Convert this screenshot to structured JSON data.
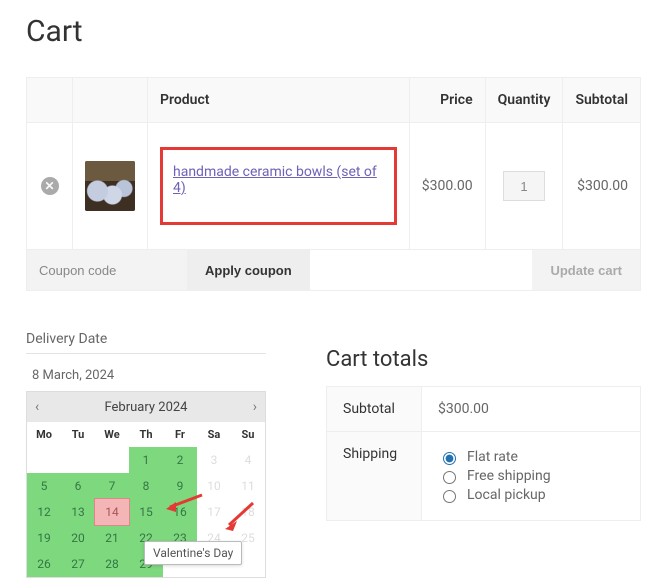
{
  "page_title": "Cart",
  "table": {
    "headers": {
      "product": "Product",
      "price": "Price",
      "quantity": "Quantity",
      "subtotal": "Subtotal"
    },
    "item": {
      "name": "handmade ceramic bowls (set of 4)",
      "price": "$300.00",
      "qty": "1",
      "subtotal": "$300.00"
    }
  },
  "coupon": {
    "placeholder": "Coupon code",
    "apply": "Apply coupon",
    "update": "Update cart"
  },
  "delivery": {
    "label": "Delivery Date",
    "value": "8 March, 2024",
    "month": "February 2024",
    "tooltip": "Valentine's Day",
    "weekdays": [
      "Mo",
      "Tu",
      "We",
      "Th",
      "Fr",
      "Sa",
      "Su"
    ],
    "weeks": [
      [
        {
          "d": "",
          "t": "blank"
        },
        {
          "d": "",
          "t": "blank"
        },
        {
          "d": "",
          "t": "blank"
        },
        {
          "d": "1",
          "t": "avail"
        },
        {
          "d": "2",
          "t": "avail"
        },
        {
          "d": "3",
          "t": "dis"
        },
        {
          "d": "4",
          "t": "dis"
        }
      ],
      [
        {
          "d": "5",
          "t": "avail"
        },
        {
          "d": "6",
          "t": "avail"
        },
        {
          "d": "7",
          "t": "avail"
        },
        {
          "d": "8",
          "t": "avail"
        },
        {
          "d": "9",
          "t": "avail"
        },
        {
          "d": "10",
          "t": "dis"
        },
        {
          "d": "11",
          "t": "dis"
        }
      ],
      [
        {
          "d": "12",
          "t": "avail"
        },
        {
          "d": "13",
          "t": "avail"
        },
        {
          "d": "14",
          "t": "selected"
        },
        {
          "d": "15",
          "t": "avail"
        },
        {
          "d": "16",
          "t": "avail"
        },
        {
          "d": "17",
          "t": "dis"
        },
        {
          "d": "18",
          "t": "dis"
        }
      ],
      [
        {
          "d": "19",
          "t": "avail"
        },
        {
          "d": "20",
          "t": "avail"
        },
        {
          "d": "21",
          "t": "avail"
        },
        {
          "d": "22",
          "t": "avail"
        },
        {
          "d": "23",
          "t": "avail"
        },
        {
          "d": "24",
          "t": "dis"
        },
        {
          "d": "25",
          "t": "dis"
        }
      ],
      [
        {
          "d": "26",
          "t": "avail"
        },
        {
          "d": "27",
          "t": "avail"
        },
        {
          "d": "28",
          "t": "avail"
        },
        {
          "d": "29",
          "t": "avail"
        },
        {
          "d": "",
          "t": "blank"
        },
        {
          "d": "",
          "t": "blank"
        },
        {
          "d": "",
          "t": "blank"
        }
      ]
    ]
  },
  "totals": {
    "title": "Cart totals",
    "subtotal_label": "Subtotal",
    "subtotal": "$300.00",
    "shipping_label": "Shipping",
    "shipping_options": [
      "Flat rate",
      "Free shipping",
      "Local pickup"
    ],
    "shipping_selected": 0
  }
}
